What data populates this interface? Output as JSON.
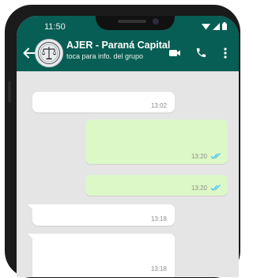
{
  "status_bar": {
    "time": "11:50"
  },
  "header": {
    "group_name": "AJER - Paraná Capital",
    "subtitle": "toca para info. del grupo"
  },
  "icons": {
    "back": "arrow-left-icon",
    "avatar": "scales-of-justice-icon",
    "video": "video-call-icon",
    "call": "phone-call-icon",
    "menu": "more-vertical-icon",
    "read": "double-check-icon"
  },
  "colors": {
    "header": "#075e54",
    "chat_bg": "#e5e5e5",
    "incoming": "#ffffff",
    "outgoing": "#dcf8c6",
    "read_ticks": "#4fc3f7"
  },
  "messages": [
    {
      "direction": "incoming",
      "text": "",
      "time": "13:02"
    },
    {
      "direction": "outgoing",
      "text": "",
      "time": "13:20",
      "status": "read"
    },
    {
      "direction": "outgoing",
      "text": "",
      "time": "13:20",
      "status": "read"
    },
    {
      "direction": "incoming",
      "text": "",
      "time": "13:18"
    },
    {
      "direction": "incoming",
      "text": "",
      "time": "13:18"
    }
  ]
}
